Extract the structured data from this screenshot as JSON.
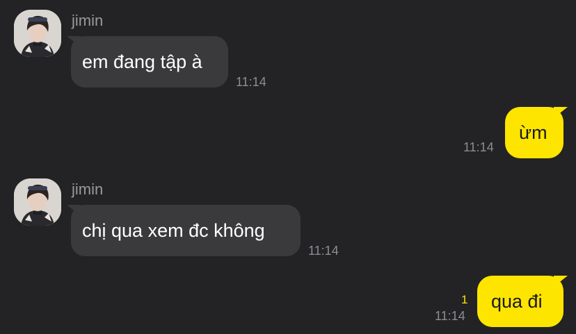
{
  "colors": {
    "background": "#232325",
    "incoming_bubble": "#3a3a3c",
    "outgoing_bubble": "#fee500",
    "unread_count": "#fee500"
  },
  "messages": [
    {
      "direction": "incoming",
      "sender": "jimin",
      "text": "em đang tập à",
      "time": "11:14"
    },
    {
      "direction": "outgoing",
      "text": "ừm",
      "time": "11:14"
    },
    {
      "direction": "incoming",
      "sender": "jimin",
      "text": "chị qua xem đc không",
      "time": "11:14"
    },
    {
      "direction": "outgoing",
      "text": "qua đi",
      "time": "11:14",
      "unread": "1"
    }
  ],
  "icons": {
    "avatar": "profile-photo"
  }
}
